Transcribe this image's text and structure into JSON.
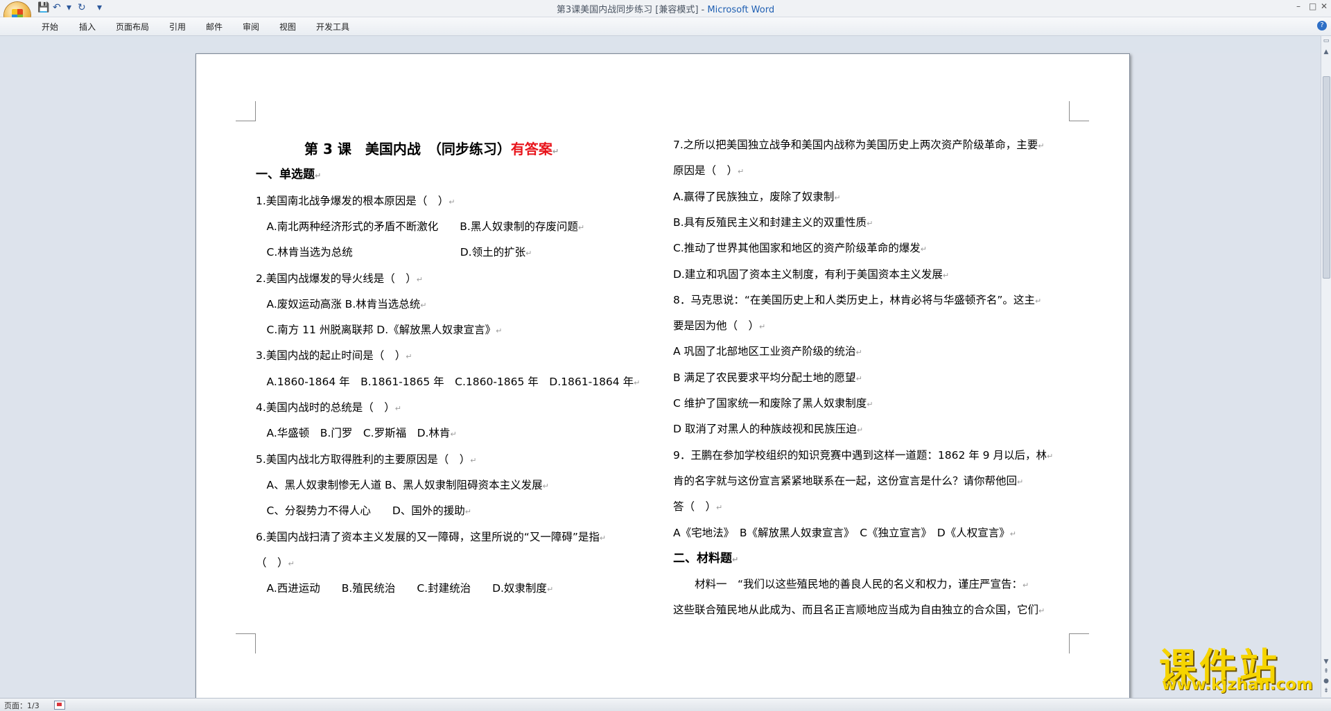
{
  "window": {
    "title": "第3课美国内战同步练习 [兼容模式] - ",
    "app_name": "Microsoft Word",
    "minimize": "–",
    "maximize": "□",
    "close": "✕"
  },
  "quick_access": {
    "save": "💾",
    "undo": "↶",
    "redo": "↻",
    "more": "▾"
  },
  "ribbon": {
    "tabs": [
      "开始",
      "插入",
      "页面布局",
      "引用",
      "邮件",
      "审阅",
      "视图",
      "开发工具"
    ],
    "help": "?"
  },
  "page_count": "页面：1/3",
  "para_mark": "↵",
  "document": {
    "left": [
      {
        "k": "h1",
        "t": "第 3 课　美国内战　（同步练习）",
        "r": "有答案"
      },
      {
        "k": "h2",
        "t": "一、单选题"
      },
      {
        "k": "p",
        "t": "1.美国南北战争爆发的根本原因是（　）"
      },
      {
        "k": "p",
        "t": "　A.南北两种经济形式的矛盾不断激化　　B.黑人奴隶制的存废问题"
      },
      {
        "k": "p",
        "t": "　C.林肯当选为总统　　　　　　　　　　D.领土的扩张"
      },
      {
        "k": "p",
        "t": "2.美国内战爆发的导火线是（　）"
      },
      {
        "k": "p",
        "t": "　A.废奴运动高涨 B.林肯当选总统"
      },
      {
        "k": "p",
        "t": "　C.南方 11 州脱离联邦 D.《解放黑人奴隶宣言》"
      },
      {
        "k": "p",
        "t": "3.美国内战的起止时间是（　）"
      },
      {
        "k": "p",
        "t": "　A.1860-1864 年　B.1861-1865 年　C.1860-1865 年　D.1861-1864 年"
      },
      {
        "k": "p",
        "t": "4.美国内战时的总统是（　）"
      },
      {
        "k": "p",
        "t": "　A.华盛顿　B.门罗　C.罗斯福　D.林肯"
      },
      {
        "k": "p",
        "t": "5.美国内战北方取得胜利的主要原因是（　）"
      },
      {
        "k": "p",
        "t": "　A、黑人奴隶制惨无人道 B、黑人奴隶制阻碍资本主义发展"
      },
      {
        "k": "p",
        "t": "　C、分裂势力不得人心　　D、国外的援助"
      },
      {
        "k": "p",
        "t": "6.美国内战扫清了资本主义发展的又一障碍，这里所说的“又一障碍”是指"
      },
      {
        "k": "p",
        "t": "（　）"
      },
      {
        "k": "p",
        "t": "　A.西进运动　　B.殖民统治　　C.封建统治　　D.奴隶制度"
      }
    ],
    "right": [
      {
        "k": "p",
        "t": "7.之所以把美国独立战争和美国内战称为美国历史上两次资产阶级革命，主要"
      },
      {
        "k": "p",
        "t": "原因是（　）"
      },
      {
        "k": "p",
        "t": "A.赢得了民族独立，废除了奴隶制"
      },
      {
        "k": "p",
        "t": "B.具有反殖民主义和封建主义的双重性质"
      },
      {
        "k": "p",
        "t": "C.推动了世界其他国家和地区的资产阶级革命的爆发"
      },
      {
        "k": "p",
        "t": "D.建立和巩固了资本主义制度，有利于美国资本主义发展"
      },
      {
        "k": "p",
        "t": "8．马克思说：“在美国历史上和人类历史上，林肯必将与华盛顿齐名”。这主"
      },
      {
        "k": "p",
        "t": "要是因为他（　）"
      },
      {
        "k": "p",
        "t": "A 巩固了北部地区工业资产阶级的统治"
      },
      {
        "k": "p",
        "t": "B 满足了农民要求平均分配土地的愿望"
      },
      {
        "k": "p",
        "t": "C 维护了国家统一和废除了黑人奴隶制度"
      },
      {
        "k": "p",
        "t": "D 取消了对黑人的种族歧视和民族压迫"
      },
      {
        "k": "p",
        "t": "9．王鹏在参加学校组织的知识竞赛中遇到这样一道题：1862 年 9 月以后，林"
      },
      {
        "k": "p",
        "t": "肯的名字就与这份宣言紧紧地联系在一起，这份宣言是什么？请你帮他回"
      },
      {
        "k": "p",
        "t": "答（　）"
      },
      {
        "k": "p",
        "t": "A《宅地法》　B《解放黑人奴隶宣言》　C《独立宣言》　D《人权宣言》"
      },
      {
        "k": "h2",
        "t": "二、材料题"
      },
      {
        "k": "p",
        "t": "　　材料一　“我们以这些殖民地的善良人民的名义和权力，谨庄严宣告："
      },
      {
        "k": "p",
        "t": "这些联合殖民地从此成为、而且名正言顺地应当成为自由独立的合众国，它们"
      }
    ]
  },
  "watermark": {
    "cn": "课件站",
    "url": "www.kjzhan.com"
  }
}
